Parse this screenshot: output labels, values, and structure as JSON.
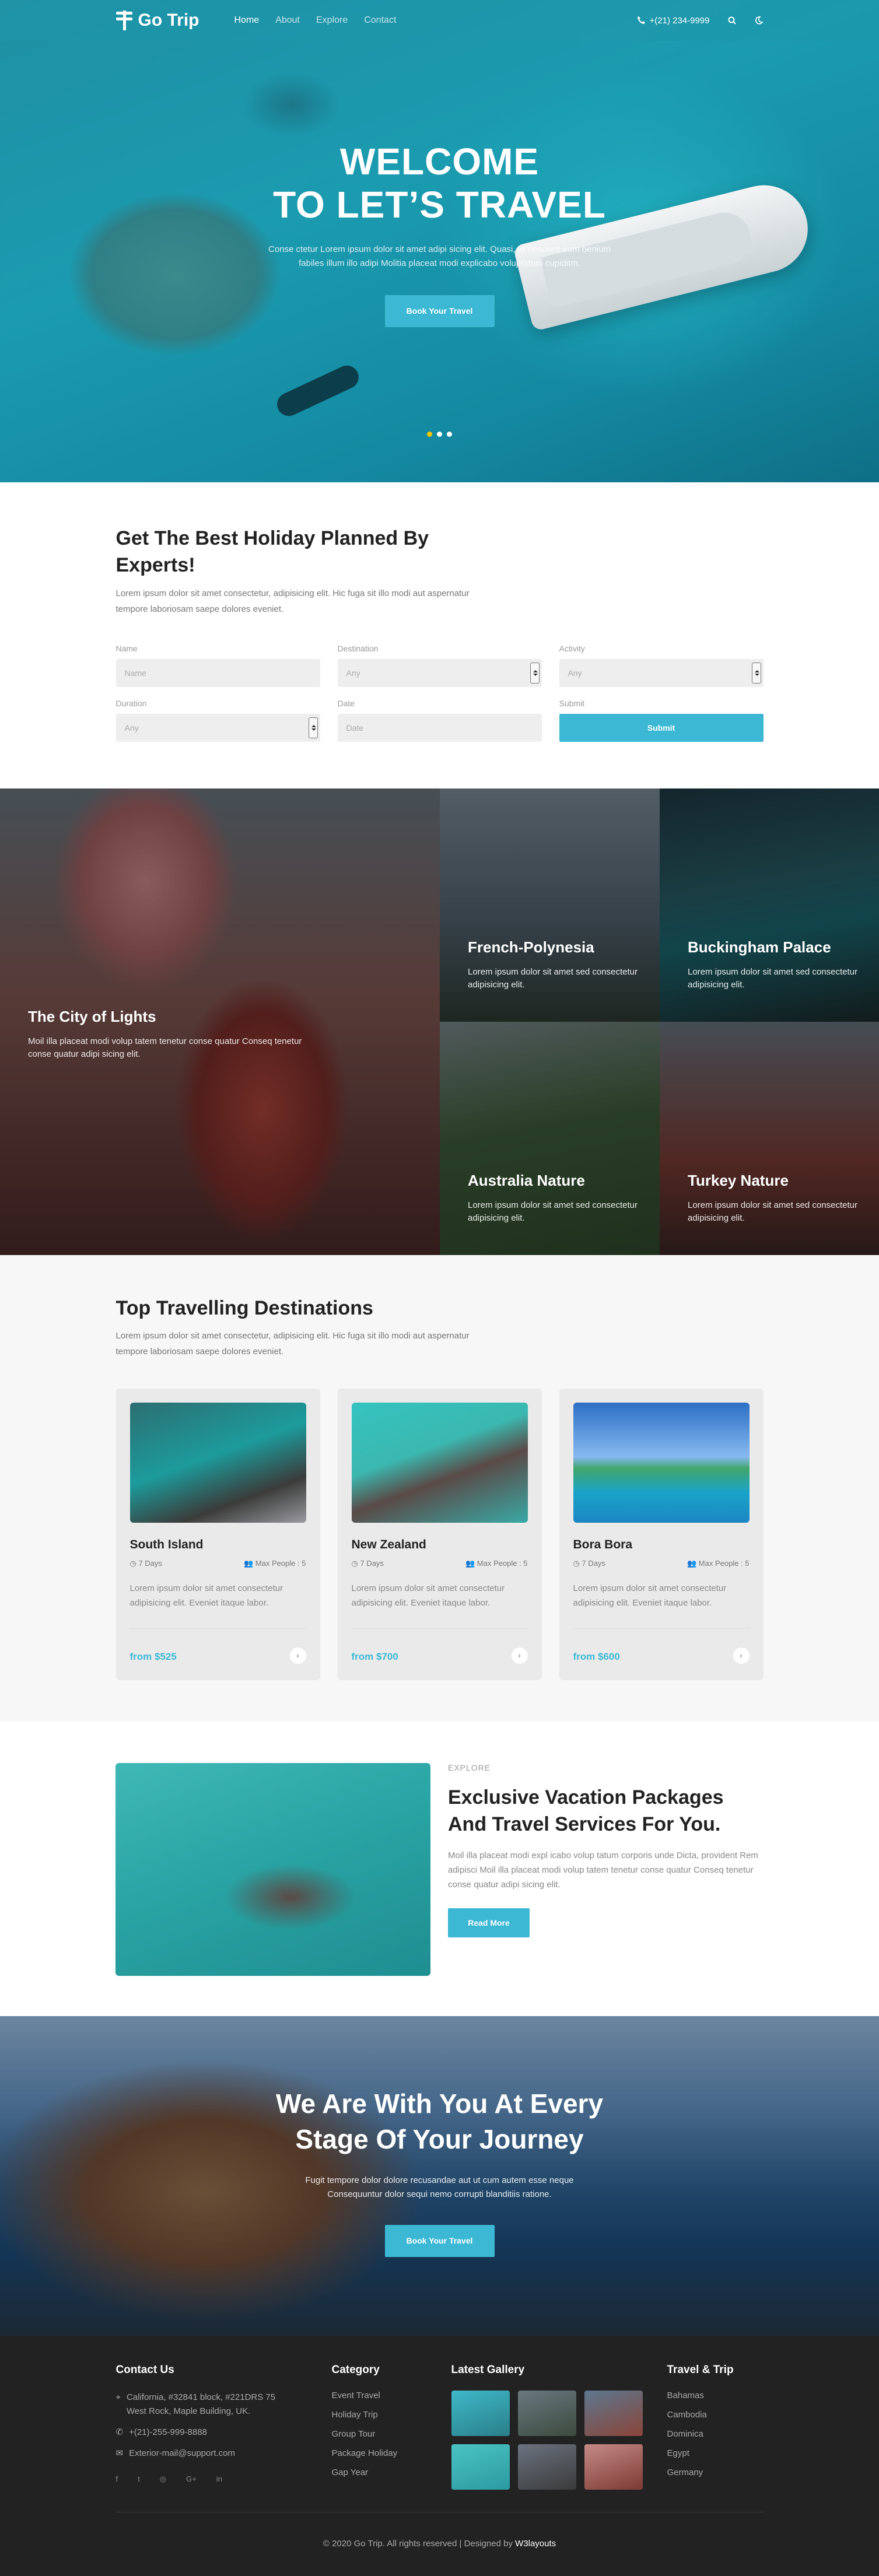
{
  "nav": {
    "brand": "Go Trip",
    "items": [
      {
        "label": "Home",
        "active": true
      },
      {
        "label": "About",
        "active": false
      },
      {
        "label": "Explore",
        "active": false
      },
      {
        "label": "Contact",
        "active": false
      }
    ],
    "phone": "+(21) 234-9999"
  },
  "hero": {
    "line1": "WELCOME",
    "line2": "TO LET’S TRAVEL",
    "text": "Conse ctetur Lorem ipsum dolor sit amet adipi sicing elit. Quasi, Id nesciunt eum benium fabiles illum illo adipi Molitia placeat modi explicabo voluptatum cupiditm.",
    "button": "Book Your Travel"
  },
  "planner": {
    "title": "Get The Best Holiday Planned By Experts!",
    "lead": "Lorem ipsum dolor sit amet consectetur, adipisicing elit. Hic fuga sit illo modi aut aspernatur tempore laboriosam saepe dolores eveniet.",
    "fields": {
      "name": {
        "label": "Name",
        "placeholder": "Name"
      },
      "destination": {
        "label": "Destination",
        "value": "Any"
      },
      "activity": {
        "label": "Activity",
        "value": "Any"
      },
      "duration": {
        "label": "Duration",
        "value": "Any"
      },
      "date": {
        "label": "Date",
        "placeholder": "Date"
      },
      "submit": {
        "label": "Submit",
        "button": "Submit"
      }
    }
  },
  "gallery": {
    "big": {
      "title": "The City of Lights",
      "text": "Moil illa placeat modi volup tatem tenetur conse quatur Conseq tenetur conse quatur adipi sicing elit."
    },
    "tiles": [
      {
        "title": "French-Polynesia",
        "text": "Lorem ipsum dolor sit amet sed consectetur adipisicing elit."
      },
      {
        "title": "Buckingham Palace",
        "text": "Lorem ipsum dolor sit amet sed consectetur adipisicing elit."
      },
      {
        "title": "Australia Nature",
        "text": "Lorem ipsum dolor sit amet sed consectetur adipisicing elit."
      },
      {
        "title": "Turkey Nature",
        "text": "Lorem ipsum dolor sit amet sed consectetur adipisicing elit."
      }
    ]
  },
  "destinations": {
    "title": "Top Travelling Destinations",
    "lead": "Lorem ipsum dolor sit amet consectetur, adipisicing elit. Hic fuga sit illo modi aut aspernatur tempore laboriosam saepe dolores eveniet.",
    "cards": [
      {
        "name": "South Island",
        "days": "7 Days",
        "people": "Max People : 5",
        "text": "Lorem ipsum dolor sit amet consectetur adipisicing elit. Eveniet itaque labor.",
        "price": "from $525"
      },
      {
        "name": "New Zealand",
        "days": "7 Days",
        "people": "Max People : 5",
        "text": "Lorem ipsum dolor sit amet consectetur adipisicing elit. Eveniet itaque labor.",
        "price": "from $700"
      },
      {
        "name": "Bora Bora",
        "days": "7 Days",
        "people": "Max People : 5",
        "text": "Lorem ipsum dolor sit amet consectetur adipisicing elit. Eveniet itaque labor.",
        "price": "from $600"
      }
    ]
  },
  "explore": {
    "tag": "EXPLORE",
    "title": "Exclusive Vacation Packages And Travel Services For You.",
    "text": "Moil illa placeat modi expl icabo volup tatum corporis unde Dicta, provident Rem adipisci Moil illa placeat modi volup tatem tenetur conse quatur Conseq tenetur conse quatur adipi sicing elit.",
    "button": "Read More"
  },
  "journey": {
    "line1": "We Are With You At Every",
    "line2": "Stage Of Your Journey",
    "text": "Fugit tempore dolor dolore recusandae aut ut cum autem esse neque Consequuntur dolor sequi nemo corrupti blanditiis ratione.",
    "button": "Book Your Travel"
  },
  "footer": {
    "contact": {
      "title": "Contact Us",
      "address": "California, #32841 block, #221DRS 75 West Rock, Maple Building, UK.",
      "phone": "+(21)-255-999-8888",
      "email": "Exterior-mail@support.com"
    },
    "category": {
      "title": "Category",
      "items": [
        "Event Travel",
        "Holiday Trip",
        "Group Tour",
        "Package Holiday",
        "Gap Year"
      ]
    },
    "gallery": {
      "title": "Latest Gallery"
    },
    "travel": {
      "title": "Travel & Trip",
      "items": [
        "Bahamas",
        "Cambodia",
        "Dominica",
        "Egypt",
        "Germany"
      ]
    },
    "copyright": "© 2020 Go Trip. All rights reserved | Designed by",
    "designer": "W3layouts"
  },
  "colors": {
    "accent": "#3cb8d4",
    "footer_bg": "#222222"
  }
}
